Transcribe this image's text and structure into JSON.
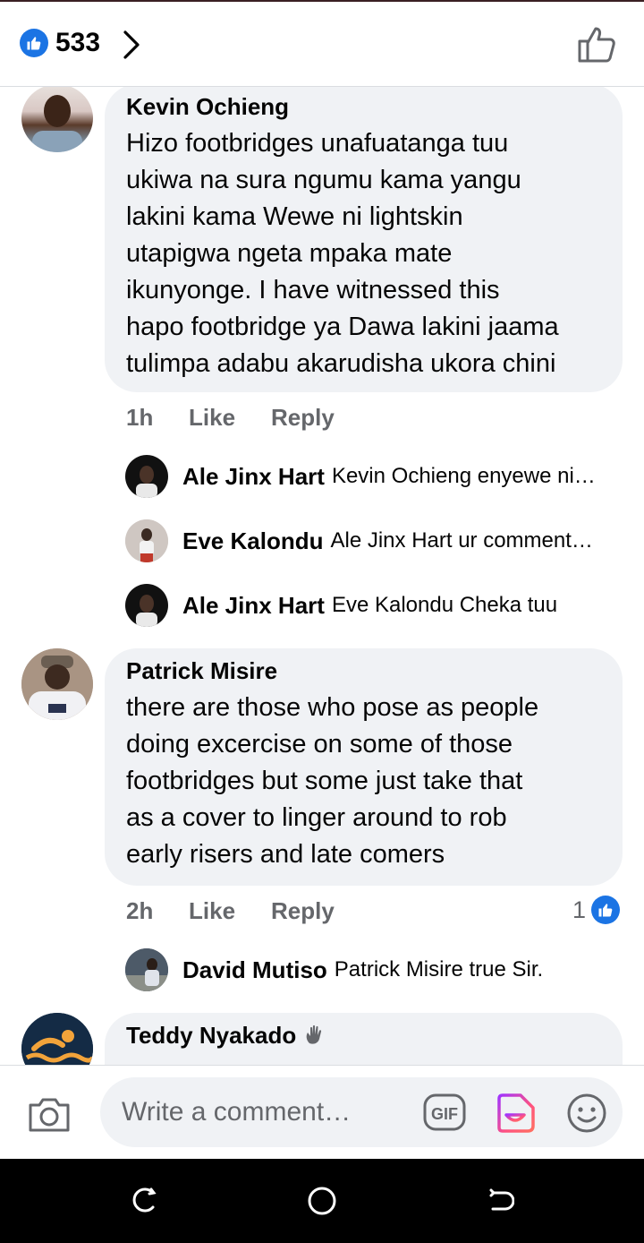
{
  "header": {
    "reaction_count": "533",
    "icons": {
      "reaction": "like-badge-icon",
      "more": "chevron-right-icon",
      "like_action": "thumbs-up-outline-icon"
    }
  },
  "comments": [
    {
      "name": "Kevin Ochieng",
      "text_lines": [
        "Hizo footbridges unafuatanga tuu",
        "ukiwa na sura ngumu kama yangu",
        "lakini kama Wewe ni lightskin",
        "utapigwa ngeta mpaka mate",
        "ikunyonge. I have witnessed this",
        "hapo footbridge ya Dawa lakini jaama",
        "tulimpa adabu akarudisha ukora chini"
      ],
      "time": "1h",
      "like": "Like",
      "reply": "Reply",
      "replies": [
        {
          "name": "Ale Jinx Hart",
          "text": "Kevin Ochieng enyewe ni…"
        },
        {
          "name": "Eve Kalondu",
          "text": "Ale Jinx Hart ur comment…"
        },
        {
          "name": "Ale Jinx Hart",
          "text": "Eve Kalondu Cheka tuu"
        }
      ]
    },
    {
      "name": "Patrick Misire",
      "text_lines": [
        "there are those who pose as people",
        "doing excercise on some of those",
        "footbridges but some just take that",
        "as a cover to linger around to rob",
        "early risers and late comers"
      ],
      "time": "2h",
      "like": "Like",
      "reply": "Reply",
      "reaction_count": "1",
      "replies": [
        {
          "name": "David Mutiso",
          "text": "Patrick Misire true Sir."
        }
      ]
    },
    {
      "name": "Teddy Nyakado",
      "badge_icon": "waving-hand-icon"
    }
  ],
  "composer": {
    "placeholder": "Write a comment…",
    "gif_label": "GIF",
    "icons": [
      "camera-icon",
      "gif-icon",
      "sticker-icon",
      "emoji-icon"
    ]
  },
  "navbar": {
    "icons": [
      "recent-apps-icon",
      "home-icon",
      "back-icon"
    ]
  },
  "colors": {
    "brand": "#1b74e4",
    "bubble": "#f0f2f5",
    "muted": "#65676b"
  }
}
